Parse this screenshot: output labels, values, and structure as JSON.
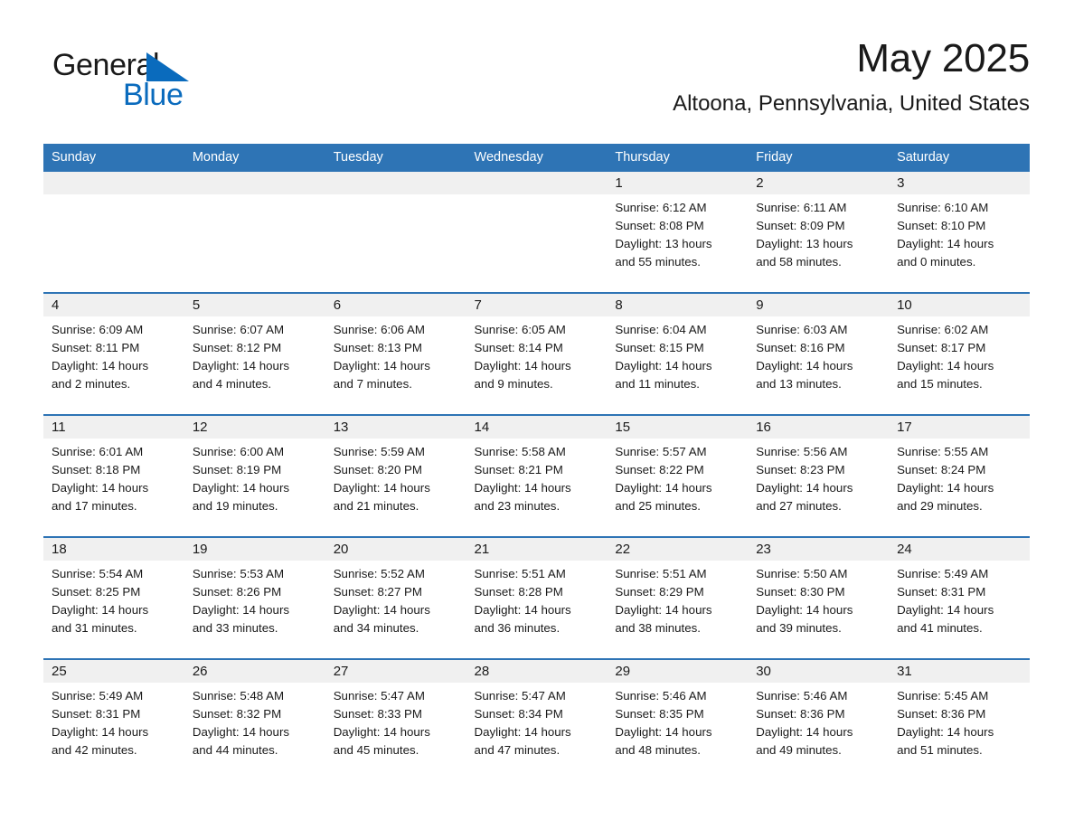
{
  "brand": {
    "name_part1": "General",
    "name_part2": "Blue",
    "triangle_color": "#0a6bbd",
    "text_color": "#1a1a1a"
  },
  "header": {
    "month_title": "May 2025",
    "location": "Altoona, Pennsylvania, United States"
  },
  "theme": {
    "header_blue": "#2e74b5",
    "daynum_band_gray": "#f0f0f0",
    "page_background": "#ffffff",
    "text": "#1a1a1a"
  },
  "weekday_headers": [
    "Sunday",
    "Monday",
    "Tuesday",
    "Wednesday",
    "Thursday",
    "Friday",
    "Saturday"
  ],
  "calendar": {
    "weeks": [
      [
        {
          "day": "",
          "empty": true,
          "sunrise": "",
          "sunset": "",
          "daylight_l1": "",
          "daylight_l2": ""
        },
        {
          "day": "",
          "empty": true,
          "sunrise": "",
          "sunset": "",
          "daylight_l1": "",
          "daylight_l2": ""
        },
        {
          "day": "",
          "empty": true,
          "sunrise": "",
          "sunset": "",
          "daylight_l1": "",
          "daylight_l2": ""
        },
        {
          "day": "",
          "empty": true,
          "sunrise": "",
          "sunset": "",
          "daylight_l1": "",
          "daylight_l2": ""
        },
        {
          "day": "1",
          "empty": false,
          "sunrise": "Sunrise: 6:12 AM",
          "sunset": "Sunset: 8:08 PM",
          "daylight_l1": "Daylight: 13 hours",
          "daylight_l2": "and 55 minutes."
        },
        {
          "day": "2",
          "empty": false,
          "sunrise": "Sunrise: 6:11 AM",
          "sunset": "Sunset: 8:09 PM",
          "daylight_l1": "Daylight: 13 hours",
          "daylight_l2": "and 58 minutes."
        },
        {
          "day": "3",
          "empty": false,
          "sunrise": "Sunrise: 6:10 AM",
          "sunset": "Sunset: 8:10 PM",
          "daylight_l1": "Daylight: 14 hours",
          "daylight_l2": "and 0 minutes."
        }
      ],
      [
        {
          "day": "4",
          "empty": false,
          "sunrise": "Sunrise: 6:09 AM",
          "sunset": "Sunset: 8:11 PM",
          "daylight_l1": "Daylight: 14 hours",
          "daylight_l2": "and 2 minutes."
        },
        {
          "day": "5",
          "empty": false,
          "sunrise": "Sunrise: 6:07 AM",
          "sunset": "Sunset: 8:12 PM",
          "daylight_l1": "Daylight: 14 hours",
          "daylight_l2": "and 4 minutes."
        },
        {
          "day": "6",
          "empty": false,
          "sunrise": "Sunrise: 6:06 AM",
          "sunset": "Sunset: 8:13 PM",
          "daylight_l1": "Daylight: 14 hours",
          "daylight_l2": "and 7 minutes."
        },
        {
          "day": "7",
          "empty": false,
          "sunrise": "Sunrise: 6:05 AM",
          "sunset": "Sunset: 8:14 PM",
          "daylight_l1": "Daylight: 14 hours",
          "daylight_l2": "and 9 minutes."
        },
        {
          "day": "8",
          "empty": false,
          "sunrise": "Sunrise: 6:04 AM",
          "sunset": "Sunset: 8:15 PM",
          "daylight_l1": "Daylight: 14 hours",
          "daylight_l2": "and 11 minutes."
        },
        {
          "day": "9",
          "empty": false,
          "sunrise": "Sunrise: 6:03 AM",
          "sunset": "Sunset: 8:16 PM",
          "daylight_l1": "Daylight: 14 hours",
          "daylight_l2": "and 13 minutes."
        },
        {
          "day": "10",
          "empty": false,
          "sunrise": "Sunrise: 6:02 AM",
          "sunset": "Sunset: 8:17 PM",
          "daylight_l1": "Daylight: 14 hours",
          "daylight_l2": "and 15 minutes."
        }
      ],
      [
        {
          "day": "11",
          "empty": false,
          "sunrise": "Sunrise: 6:01 AM",
          "sunset": "Sunset: 8:18 PM",
          "daylight_l1": "Daylight: 14 hours",
          "daylight_l2": "and 17 minutes."
        },
        {
          "day": "12",
          "empty": false,
          "sunrise": "Sunrise: 6:00 AM",
          "sunset": "Sunset: 8:19 PM",
          "daylight_l1": "Daylight: 14 hours",
          "daylight_l2": "and 19 minutes."
        },
        {
          "day": "13",
          "empty": false,
          "sunrise": "Sunrise: 5:59 AM",
          "sunset": "Sunset: 8:20 PM",
          "daylight_l1": "Daylight: 14 hours",
          "daylight_l2": "and 21 minutes."
        },
        {
          "day": "14",
          "empty": false,
          "sunrise": "Sunrise: 5:58 AM",
          "sunset": "Sunset: 8:21 PM",
          "daylight_l1": "Daylight: 14 hours",
          "daylight_l2": "and 23 minutes."
        },
        {
          "day": "15",
          "empty": false,
          "sunrise": "Sunrise: 5:57 AM",
          "sunset": "Sunset: 8:22 PM",
          "daylight_l1": "Daylight: 14 hours",
          "daylight_l2": "and 25 minutes."
        },
        {
          "day": "16",
          "empty": false,
          "sunrise": "Sunrise: 5:56 AM",
          "sunset": "Sunset: 8:23 PM",
          "daylight_l1": "Daylight: 14 hours",
          "daylight_l2": "and 27 minutes."
        },
        {
          "day": "17",
          "empty": false,
          "sunrise": "Sunrise: 5:55 AM",
          "sunset": "Sunset: 8:24 PM",
          "daylight_l1": "Daylight: 14 hours",
          "daylight_l2": "and 29 minutes."
        }
      ],
      [
        {
          "day": "18",
          "empty": false,
          "sunrise": "Sunrise: 5:54 AM",
          "sunset": "Sunset: 8:25 PM",
          "daylight_l1": "Daylight: 14 hours",
          "daylight_l2": "and 31 minutes."
        },
        {
          "day": "19",
          "empty": false,
          "sunrise": "Sunrise: 5:53 AM",
          "sunset": "Sunset: 8:26 PM",
          "daylight_l1": "Daylight: 14 hours",
          "daylight_l2": "and 33 minutes."
        },
        {
          "day": "20",
          "empty": false,
          "sunrise": "Sunrise: 5:52 AM",
          "sunset": "Sunset: 8:27 PM",
          "daylight_l1": "Daylight: 14 hours",
          "daylight_l2": "and 34 minutes."
        },
        {
          "day": "21",
          "empty": false,
          "sunrise": "Sunrise: 5:51 AM",
          "sunset": "Sunset: 8:28 PM",
          "daylight_l1": "Daylight: 14 hours",
          "daylight_l2": "and 36 minutes."
        },
        {
          "day": "22",
          "empty": false,
          "sunrise": "Sunrise: 5:51 AM",
          "sunset": "Sunset: 8:29 PM",
          "daylight_l1": "Daylight: 14 hours",
          "daylight_l2": "and 38 minutes."
        },
        {
          "day": "23",
          "empty": false,
          "sunrise": "Sunrise: 5:50 AM",
          "sunset": "Sunset: 8:30 PM",
          "daylight_l1": "Daylight: 14 hours",
          "daylight_l2": "and 39 minutes."
        },
        {
          "day": "24",
          "empty": false,
          "sunrise": "Sunrise: 5:49 AM",
          "sunset": "Sunset: 8:31 PM",
          "daylight_l1": "Daylight: 14 hours",
          "daylight_l2": "and 41 minutes."
        }
      ],
      [
        {
          "day": "25",
          "empty": false,
          "sunrise": "Sunrise: 5:49 AM",
          "sunset": "Sunset: 8:31 PM",
          "daylight_l1": "Daylight: 14 hours",
          "daylight_l2": "and 42 minutes."
        },
        {
          "day": "26",
          "empty": false,
          "sunrise": "Sunrise: 5:48 AM",
          "sunset": "Sunset: 8:32 PM",
          "daylight_l1": "Daylight: 14 hours",
          "daylight_l2": "and 44 minutes."
        },
        {
          "day": "27",
          "empty": false,
          "sunrise": "Sunrise: 5:47 AM",
          "sunset": "Sunset: 8:33 PM",
          "daylight_l1": "Daylight: 14 hours",
          "daylight_l2": "and 45 minutes."
        },
        {
          "day": "28",
          "empty": false,
          "sunrise": "Sunrise: 5:47 AM",
          "sunset": "Sunset: 8:34 PM",
          "daylight_l1": "Daylight: 14 hours",
          "daylight_l2": "and 47 minutes."
        },
        {
          "day": "29",
          "empty": false,
          "sunrise": "Sunrise: 5:46 AM",
          "sunset": "Sunset: 8:35 PM",
          "daylight_l1": "Daylight: 14 hours",
          "daylight_l2": "and 48 minutes."
        },
        {
          "day": "30",
          "empty": false,
          "sunrise": "Sunrise: 5:46 AM",
          "sunset": "Sunset: 8:36 PM",
          "daylight_l1": "Daylight: 14 hours",
          "daylight_l2": "and 49 minutes."
        },
        {
          "day": "31",
          "empty": false,
          "sunrise": "Sunrise: 5:45 AM",
          "sunset": "Sunset: 8:36 PM",
          "daylight_l1": "Daylight: 14 hours",
          "daylight_l2": "and 51 minutes."
        }
      ]
    ]
  }
}
